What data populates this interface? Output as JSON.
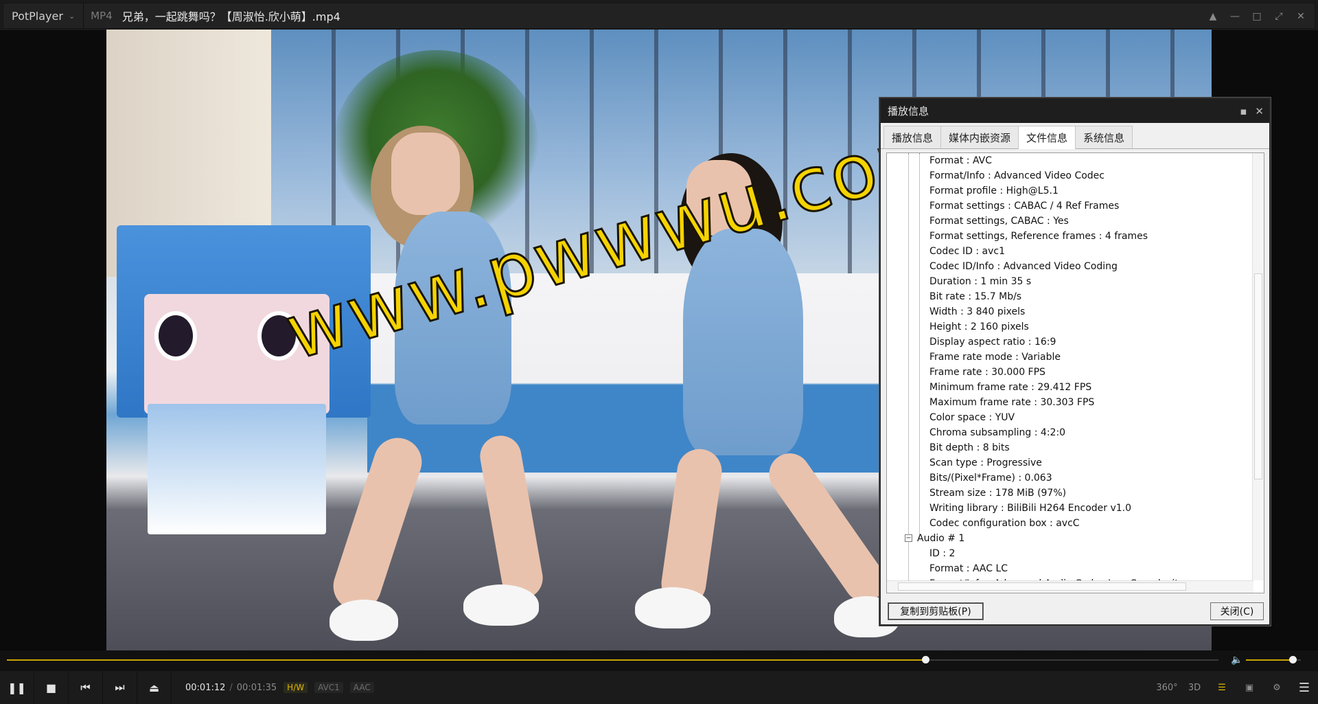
{
  "app": {
    "name": "PotPlayer",
    "format": "MP4",
    "title": "兄弟，一起跳舞吗？【周淑怡.欣小萌】.mp4"
  },
  "window_controls": {
    "pin": "pin-icon",
    "minimize": "minimize-icon",
    "maximize": "maximize-icon",
    "fullscreen": "fullscreen-icon",
    "close": "close-icon"
  },
  "video": {
    "watermark": "www.pwwwu.com"
  },
  "info_dialog": {
    "title": "播放信息",
    "tabs": [
      {
        "label": "播放信息",
        "active": false
      },
      {
        "label": "媒体内嵌资源",
        "active": false
      },
      {
        "label": "文件信息",
        "active": true
      },
      {
        "label": "系统信息",
        "active": false
      }
    ],
    "video_rows": [
      "Format : AVC",
      "Format/Info : Advanced Video Codec",
      "Format profile : High@L5.1",
      "Format settings : CABAC / 4 Ref Frames",
      "Format settings, CABAC : Yes",
      "Format settings, Reference frames : 4 frames",
      "Codec ID : avc1",
      "Codec ID/Info : Advanced Video Coding",
      "Duration : 1 min 35 s",
      "Bit rate : 15.7 Mb/s",
      "Width : 3 840 pixels",
      "Height : 2 160 pixels",
      "Display aspect ratio : 16:9",
      "Frame rate mode : Variable",
      "Frame rate : 30.000 FPS",
      "Minimum frame rate : 29.412 FPS",
      "Maximum frame rate : 30.303 FPS",
      "Color space : YUV",
      "Chroma subsampling : 4:2:0",
      "Bit depth : 8 bits",
      "Scan type : Progressive",
      "Bits/(Pixel*Frame) : 0.063",
      "Stream size : 178 MiB (97%)",
      "Writing library : BiliBili H264 Encoder v1.0",
      "Codec configuration box : avcC"
    ],
    "audio_node": "Audio # 1",
    "audio_rows": [
      "ID : 2",
      "Format : AAC LC",
      "Format/Info : Advanced Audio Codec Low Complexity"
    ],
    "copy_button": "复制到剪贴板(P)",
    "close_button": "关闭(C)"
  },
  "playback": {
    "current_time": "00:01:12",
    "separator": "/",
    "total_time": "00:01:35",
    "progress": 0.758,
    "volume": 0.85,
    "tags": [
      "H/W",
      "AVC1",
      "AAC"
    ],
    "right_controls": {
      "vr": "360°",
      "threed": "3D"
    }
  }
}
